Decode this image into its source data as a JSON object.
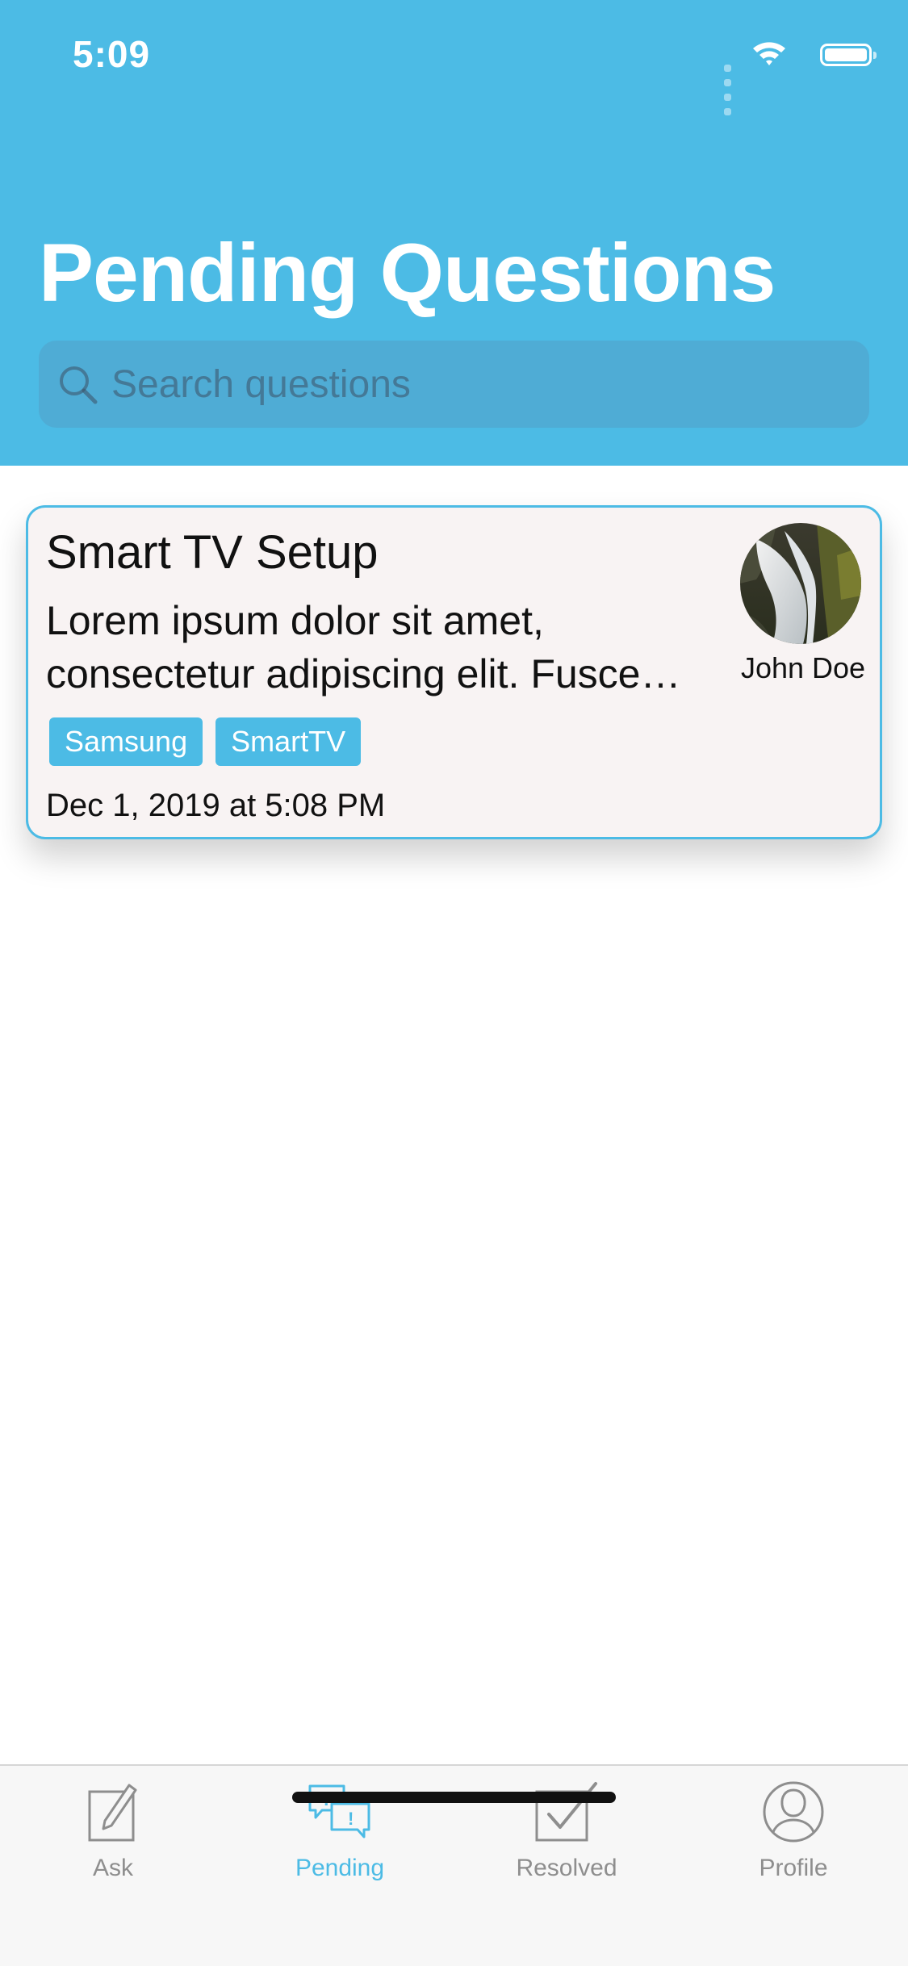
{
  "status_bar": {
    "time": "5:09"
  },
  "header": {
    "title": "Pending Questions",
    "search_placeholder": "Search questions"
  },
  "questions": [
    {
      "title": "Smart TV Setup",
      "body": "Lorem ipsum dolor sit amet,\nconsectetur adipiscing elit. Fusce…",
      "tags": [
        "Samsung",
        "SmartTV"
      ],
      "date": "Dec 1, 2019 at 5:08 PM",
      "author": "John Doe"
    }
  ],
  "tabbar": {
    "tabs": [
      {
        "label": "Ask",
        "icon": "pencil-square-icon"
      },
      {
        "label": "Pending",
        "icon": "chat-bubbles-icon"
      },
      {
        "label": "Resolved",
        "icon": "check-square-icon"
      },
      {
        "label": "Profile",
        "icon": "user-circle-icon"
      }
    ],
    "active": "Pending"
  },
  "colors": {
    "accent": "#4cbbe5",
    "card_background": "#f8f3f3",
    "inactive_tab": "#8e8e8e"
  }
}
